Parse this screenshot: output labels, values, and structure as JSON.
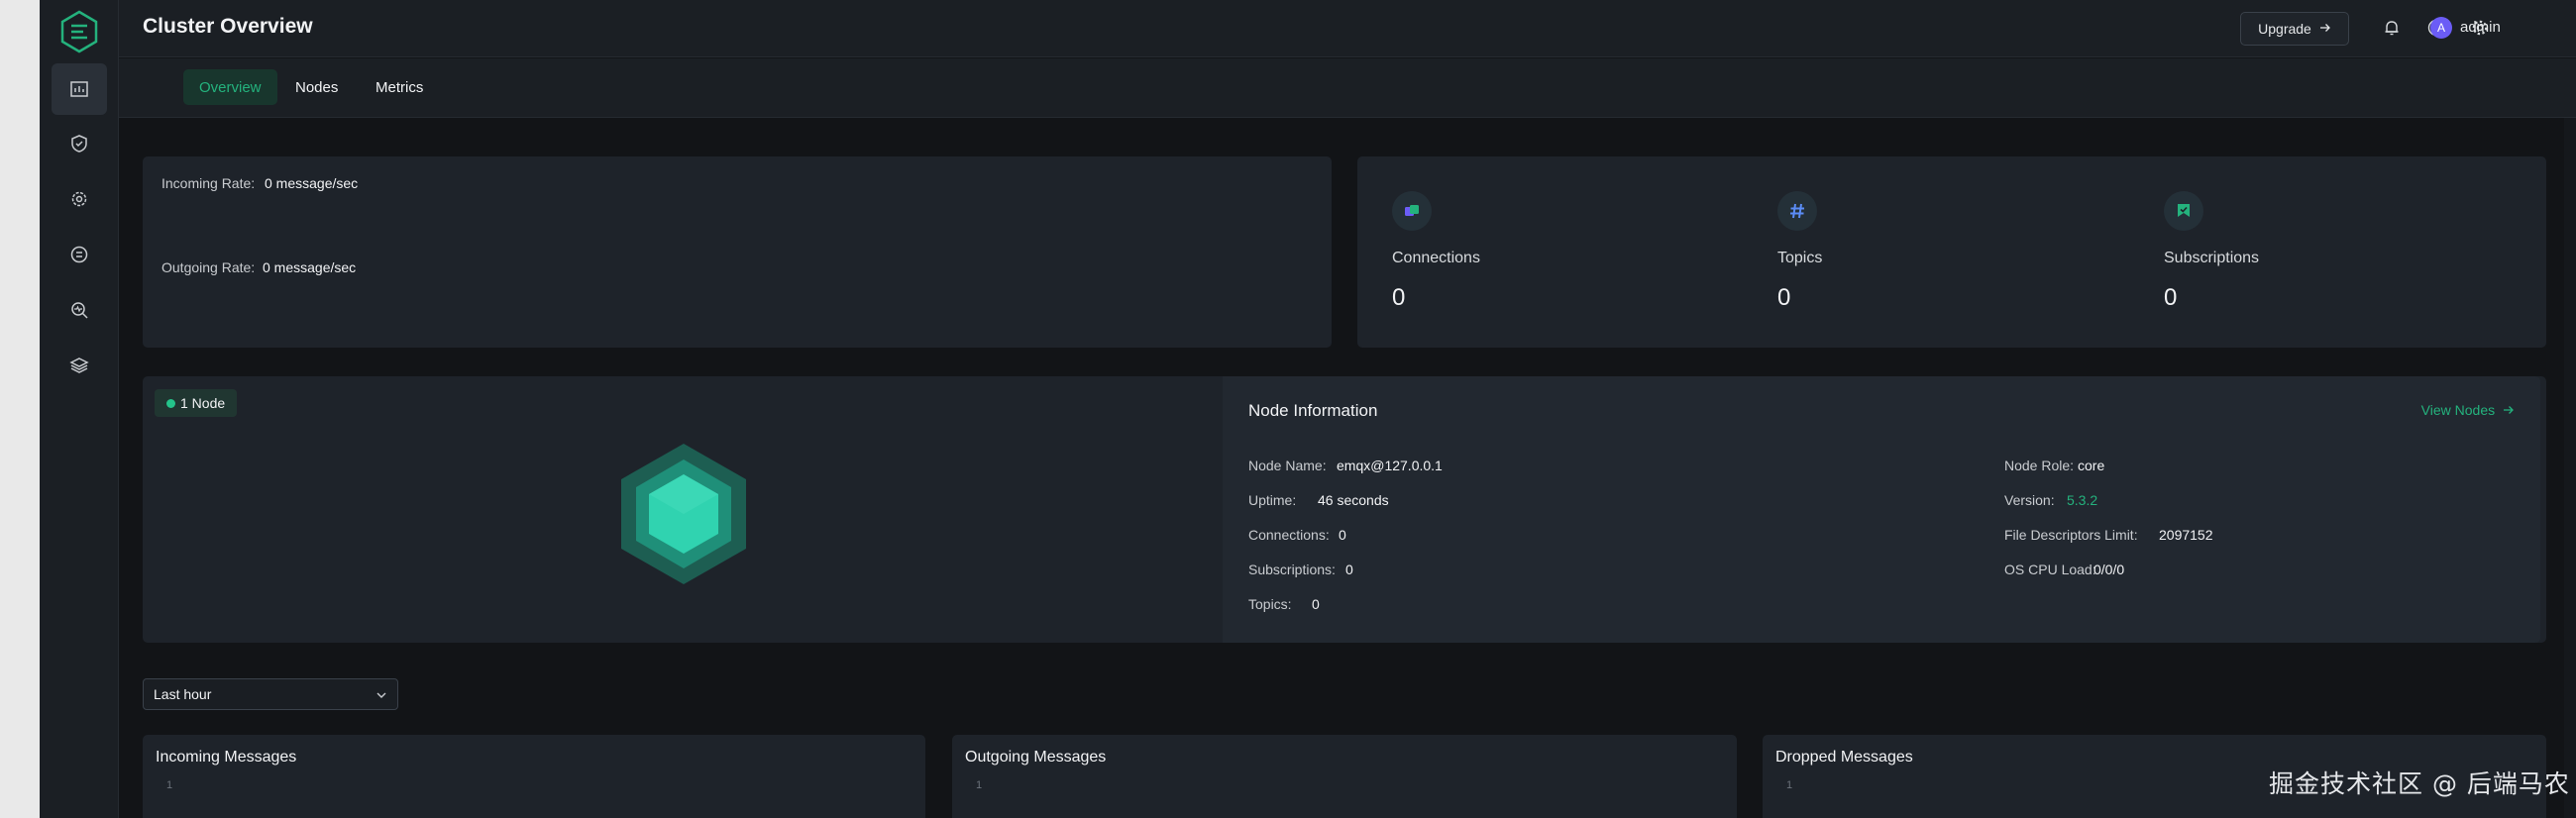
{
  "header": {
    "title": "Cluster Overview",
    "upgrade_label": "Upgrade",
    "username": "admin",
    "avatar_initial": "A"
  },
  "tabs": [
    {
      "label": "Overview",
      "active": true
    },
    {
      "label": "Nodes",
      "active": false
    },
    {
      "label": "Metrics",
      "active": false
    }
  ],
  "sidebar": {
    "items": [
      {
        "icon": "dashboard-icon",
        "active": true
      },
      {
        "icon": "shield-icon",
        "active": false
      },
      {
        "icon": "gear-cycle-icon",
        "active": false
      },
      {
        "icon": "database-icon",
        "active": false
      },
      {
        "icon": "diagnose-icon",
        "active": false
      },
      {
        "icon": "stack-icon",
        "active": false
      }
    ]
  },
  "rates": {
    "incoming_label": "Incoming Rate:",
    "incoming_value": "0 message/sec",
    "outgoing_label": "Outgoing Rate:",
    "outgoing_value": "0 message/sec"
  },
  "stats": [
    {
      "label": "Connections",
      "value": "0",
      "icon": "connections-icon"
    },
    {
      "label": "Topics",
      "value": "0",
      "icon": "hash-icon"
    },
    {
      "label": "Subscriptions",
      "value": "0",
      "icon": "subscriptions-icon"
    }
  ],
  "cluster": {
    "node_badge": "1 Node"
  },
  "node_info": {
    "title": "Node Information",
    "view_nodes": "View Nodes",
    "left": [
      {
        "label": "Node Name:",
        "value": "emqx@127.0.0.1"
      },
      {
        "label": "Uptime:",
        "value": "46 seconds"
      },
      {
        "label": "Connections:",
        "value": "0"
      },
      {
        "label": "Subscriptions:",
        "value": "0"
      },
      {
        "label": "Topics:",
        "value": "0"
      }
    ],
    "right": [
      {
        "label": "Node Role:",
        "value": "core"
      },
      {
        "label": "Version:",
        "value": "5.3.2"
      },
      {
        "label": "File Descriptors Limit:",
        "value": "2097152"
      },
      {
        "label": "OS CPU Load:",
        "value": "0/0/0"
      }
    ]
  },
  "time_range": {
    "selected": "Last hour"
  },
  "charts": [
    {
      "title": "Incoming Messages",
      "tick": "1"
    },
    {
      "title": "Outgoing Messages",
      "tick": "1"
    },
    {
      "title": "Dropped Messages",
      "tick": "1"
    }
  ],
  "watermark": "掘金技术社区 @ 后端马农",
  "colors": {
    "accent": "#24b27d",
    "background": "#121417",
    "card": "#1e232a"
  }
}
